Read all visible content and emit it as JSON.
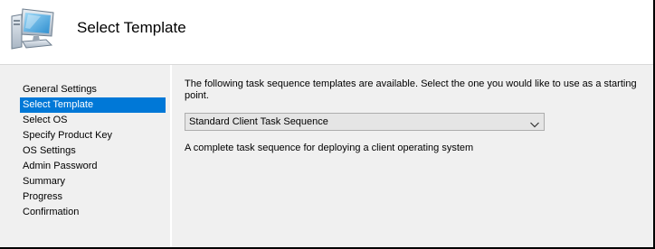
{
  "header": {
    "title": "Select Template",
    "icon": "computer-icon"
  },
  "sidebar": {
    "items": [
      {
        "label": "General Settings",
        "selected": false
      },
      {
        "label": "Select Template",
        "selected": true
      },
      {
        "label": "Select OS",
        "selected": false
      },
      {
        "label": "Specify Product Key",
        "selected": false
      },
      {
        "label": "OS Settings",
        "selected": false
      },
      {
        "label": "Admin Password",
        "selected": false
      },
      {
        "label": "Summary",
        "selected": false
      },
      {
        "label": "Progress",
        "selected": false
      },
      {
        "label": "Confirmation",
        "selected": false
      }
    ]
  },
  "main": {
    "intro": "The following task sequence templates are available.  Select the one you would like to use as a starting point.",
    "template_select": {
      "value": "Standard Client Task Sequence"
    },
    "description": "A complete task sequence for deploying a client operating system"
  },
  "colors": {
    "selection": "#0078d7",
    "panel_background": "#f0f0f0",
    "header_background": "#ffffff"
  }
}
